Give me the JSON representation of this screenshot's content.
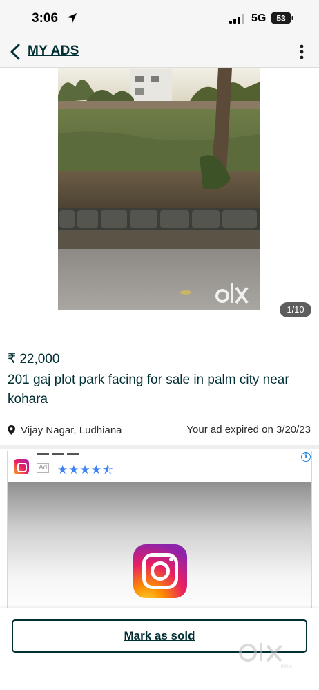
{
  "status_bar": {
    "time": "3:06",
    "network": "5G",
    "battery": "53"
  },
  "header": {
    "title": "MY ADS"
  },
  "photo": {
    "counter": "1/10",
    "watermark": "olx"
  },
  "listing": {
    "price": "₹ 22,000",
    "title": "201 gaj plot park facing for sale in palm city near kohara",
    "location": "Vijay Nagar, Ludhiana",
    "expiry": "Your ad expired on 3/20/23"
  },
  "ad": {
    "badge": "Ad",
    "stars": "★★★★⯪",
    "rating": 4.5,
    "info_icon": "i"
  },
  "actions": {
    "mark_sold_label": "Mark as sold"
  },
  "watermark": {
    "brand": "olx",
    "sub": "INDIA"
  },
  "colors": {
    "brand": "#002f34",
    "ad_star": "#3b82f6",
    "ad_info": "#1e88e5"
  }
}
